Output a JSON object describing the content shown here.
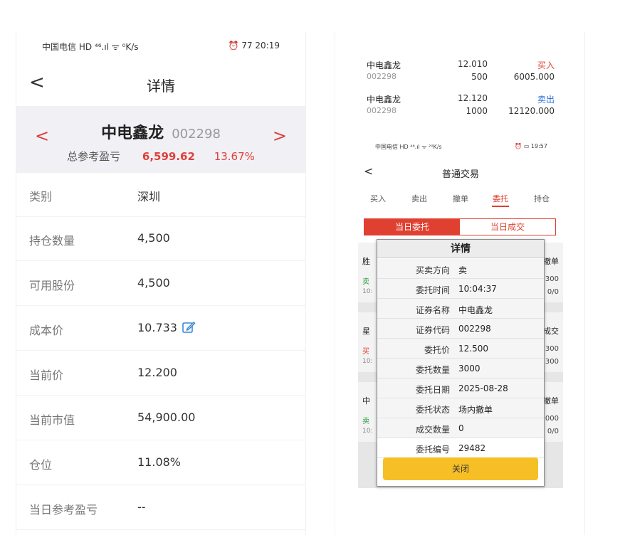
{
  "left": {
    "status_bar": {
      "carrier": "中国电信 HD ⁴⁶.ıl ᯤ ⁰K/s",
      "right": "⏰ 77 20:19"
    },
    "header": {
      "back": "<",
      "title": "详情"
    },
    "summary": {
      "prev": "<",
      "next": ">",
      "stock_name": "中电鑫龙",
      "stock_code": "002298",
      "pl_label": "总参考盈亏",
      "pl_value": "6,599.62",
      "pl_percent": "13.67%"
    },
    "rows": [
      {
        "label": "类别",
        "value": "深圳"
      },
      {
        "label": "持仓数量",
        "value": "4,500"
      },
      {
        "label": "可用股份",
        "value": "4,500"
      },
      {
        "label": "成本价",
        "value": "10.733"
      },
      {
        "label": "当前价",
        "value": "12.200"
      },
      {
        "label": "当前市值",
        "value": "54,900.00"
      },
      {
        "label": "仓位",
        "value": "11.08%"
      },
      {
        "label": "当日参考盈亏",
        "value": "--"
      }
    ],
    "icons": {
      "edit": "pencil-square-icon"
    },
    "colors": {
      "accent": "#e0403c",
      "summary_bg": "#f1f1f5"
    }
  },
  "right": {
    "trades": [
      {
        "name": "中电鑫龙",
        "code": "002298",
        "price": "12.010",
        "qty": "500",
        "dir": "买入",
        "amount": "6005.000",
        "dir_color": "#e04030"
      },
      {
        "name": "中电鑫龙",
        "code": "002298",
        "price": "12.120",
        "qty": "1000",
        "dir": "卖出",
        "amount": "12120.000",
        "dir_color": "#2a6fd8"
      }
    ],
    "inner": {
      "status_bar": {
        "carrier": "中国电信 HD ⁴⁶.ıl ᯤ ²⁰K/s",
        "right": "⏰ ▭ 19:57"
      },
      "header": {
        "back": "<",
        "title": "普通交易"
      },
      "tabs": [
        "买入",
        "卖出",
        "撤单",
        "委托",
        "持仓"
      ],
      "active_tab": "委托",
      "segments": {
        "today_orders": "当日委托",
        "today_deals": "当日成交"
      },
      "bg_rows": [
        {
          "a": "胜",
          "b": "卖",
          "c": "10:",
          "d": "撤单",
          "e": "300",
          "f": "0/0"
        },
        {
          "a": "星",
          "b": "买",
          "c": "10:",
          "d": "成交",
          "e": "300",
          "f": "300"
        },
        {
          "a": "中",
          "b": "卖",
          "c": "10:",
          "d": "撤单",
          "e": "000",
          "f": "0/0"
        }
      ],
      "dialog": {
        "title": "详情",
        "rows": [
          {
            "label": "买卖方向",
            "value": "卖"
          },
          {
            "label": "委托时间",
            "value": "10:04:37"
          },
          {
            "label": "证券名称",
            "value": "中电鑫龙"
          },
          {
            "label": "证券代码",
            "value": "002298"
          },
          {
            "label": "委托价",
            "value": "12.500"
          },
          {
            "label": "委托数量",
            "value": "3000"
          },
          {
            "label": "委托日期",
            "value": "2025-08-28"
          },
          {
            "label": "委托状态",
            "value": "场内撤单"
          },
          {
            "label": "成交数量",
            "value": "0"
          },
          {
            "label": "委托编号",
            "value": "29482"
          }
        ],
        "close_label": "关闭",
        "close_color": "#f6bf26"
      }
    }
  }
}
